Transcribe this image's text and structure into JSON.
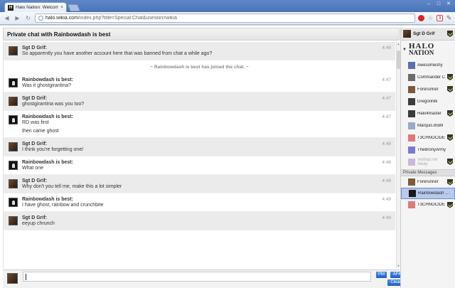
{
  "browser": {
    "tab_title": "Halo Nation: Welcome to t",
    "tab_close": "×",
    "url_host": "halo.wikia.com",
    "url_path": "/index.php?title=Special:Chat&useskin=wikia",
    "back": "◀",
    "forward": "▶",
    "reload": "↻",
    "win_min": "–",
    "win_max": "□",
    "win_close": "✕",
    "ext_gmail_label": "3"
  },
  "chat": {
    "title": "Private chat with Rainbowdash is best",
    "messages": [
      {
        "user": "Sgt D Grif:",
        "text": "So apparently you have another account here that was banned from chat a while ago?",
        "time": "4:46",
        "self": true
      },
      {
        "alert": "~ Rainbowdash is best has joined the chat. ~"
      },
      {
        "user": "Rainbowdash is best:",
        "text": "Was it ghostgirantina?",
        "time": "4:47"
      },
      {
        "user": "Sgt D Grif:",
        "text": "ghostgirantina was you too?",
        "time": "4:47",
        "self": true
      },
      {
        "user": "Rainbowdash is best:",
        "text": "RD was first",
        "text2": "then came ghost",
        "time": "4:47"
      },
      {
        "user": "Sgt D Grif:",
        "text": "I think you're forgetting one/",
        "time": "4:48",
        "self": true
      },
      {
        "user": "Rainbowdash is best:",
        "text": "What one",
        "time": "4:48"
      },
      {
        "user": "Sgt D Grif:",
        "text": "Why don't you tell me, make this a lot simpler",
        "time": "4:48",
        "self": true
      },
      {
        "user": "Rainbowdash is best:",
        "text": "I have ghost, rainbow and crunchbite",
        "time": "4:49"
      },
      {
        "user": "Sgt D Grif:",
        "text": "eeyup chrunch",
        "time": "4:49",
        "self": true
      }
    ]
  },
  "composer": {
    "pm_label": "PM",
    "afk_label": "AFK",
    "clear_label": "Clear"
  },
  "sidebar": {
    "me": "Sgt D Grif",
    "logo_line1": "HALO",
    "logo_line2": "NATION",
    "users": [
      {
        "name": "Awesomeshy",
        "badge": false,
        "color": "#5a6fb0"
      },
      {
        "name": "Commander C",
        "badge": true,
        "color": "#6b6b6b"
      },
      {
        "name": "Forerunner",
        "badge": true,
        "color": "#7a5b3b"
      },
      {
        "name": "Gregorirdk",
        "badge": false,
        "color": "#3c3c3c"
      },
      {
        "name": "Halo4master",
        "badge": true,
        "color": "#3b3b3b"
      },
      {
        "name": "Marquis.8589",
        "badge": false,
        "color": "#9aa9c9"
      },
      {
        "name": "T3CHNOCIDE",
        "badge": true,
        "color": "#e07a7a"
      },
      {
        "name": "TheBronyArmy",
        "badge": false,
        "color": "#7a7ad6"
      },
      {
        "name": "Vidmas7er",
        "sub": "Away",
        "badge": true,
        "color": "#c7b9d9",
        "away": true
      }
    ],
    "private_header": "Private Messages",
    "private": [
      {
        "name": "Forerunner",
        "badge": true,
        "color": "#7a5b3b"
      },
      {
        "name": "Rainbowdash ...",
        "badge": false,
        "color": "#1a1a1a",
        "selected": true
      },
      {
        "name": "T3CHNOCIDE",
        "badge": true,
        "color": "#e07a7a"
      }
    ]
  }
}
